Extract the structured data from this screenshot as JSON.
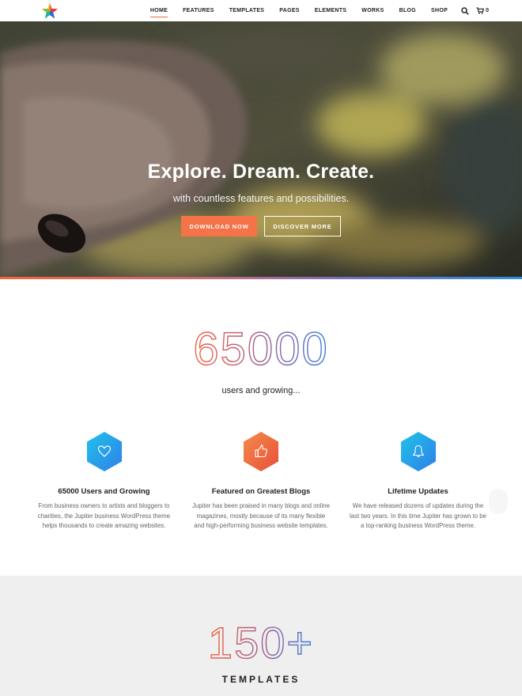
{
  "header": {
    "logo_icon": "star-logo-icon",
    "nav": [
      {
        "label": "HOME",
        "active": true
      },
      {
        "label": "FEATURES",
        "active": false
      },
      {
        "label": "TEMPLATES",
        "active": false
      },
      {
        "label": "PAGES",
        "active": false
      },
      {
        "label": "ELEMENTS",
        "active": false
      },
      {
        "label": "WORKS",
        "active": false
      },
      {
        "label": "BLOG",
        "active": false
      },
      {
        "label": "SHOP",
        "active": false
      }
    ],
    "search_icon": "search-icon",
    "cart_icon": "cart-icon",
    "cart_count": "0"
  },
  "hero": {
    "title": "Explore. Dream. Create.",
    "subtitle": "with countless features and possibilities.",
    "primary_button": "DOWNLOAD NOW",
    "secondary_button": "DISCOVER MORE"
  },
  "stats": {
    "number": "65000",
    "subtitle": "users and growing..."
  },
  "features": [
    {
      "icon": "heart-icon",
      "title": "65000 Users and Growing",
      "text_lines": [
        "From business owners to artists and bloggers to",
        "charities, the Jupiter business WordPress theme",
        "helps thousands to create amazing websites."
      ]
    },
    {
      "icon": "thumbs-up-icon",
      "title": "Featured on Greatest Blogs",
      "text_lines": [
        "Jupiter has been  praised in many blogs and online",
        "magazines, mostly because of its many flexible",
        "and high-performing business website templates."
      ]
    },
    {
      "icon": "bell-icon",
      "title": "Lifetime Updates",
      "text_lines": [
        "We have released dozens of updates during the",
        "last two years. In this time Jupiter has grown to be",
        "a top-ranking business WordPress theme."
      ]
    }
  ],
  "templates": {
    "number": "150+",
    "label": "TEMPLATES"
  },
  "colors": {
    "accent": "#f47348",
    "gradient_start": "#f3653f",
    "gradient_end": "#2f8fe0",
    "hex_blue": "#2aa7e8",
    "hex_orange": "#f0693f"
  }
}
